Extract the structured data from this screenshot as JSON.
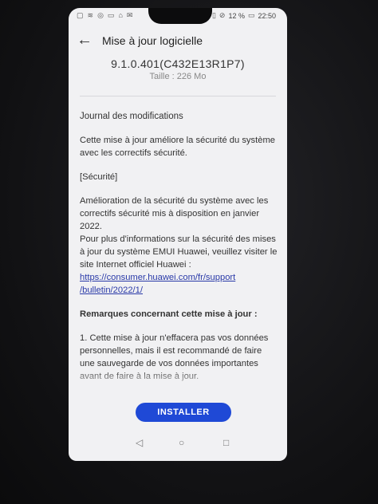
{
  "status": {
    "battery": "12 %",
    "time": "22:50"
  },
  "header": {
    "title": "Mise à jour logicielle"
  },
  "update": {
    "version": "9.1.0.401(C432E13R1P7)",
    "size": "Taille : 226 Mo"
  },
  "changelog": {
    "heading": "Journal des modifications",
    "intro": "Cette mise à jour améliore la sécurité du système avec les correctifs sécurité.",
    "section": "[Sécurité]",
    "body_lines": [
      "Amélioration de la sécurité du système avec les correctifs sécurité mis à disposition en janvier 2022.",
      "Pour plus d'informations sur la sécurité des mises à jour du système EMUI Huawei, veuillez visiter le site Internet officiel Huawei :"
    ],
    "link_line1": "https://consumer.huawei.com/fr/support",
    "link_line2": "/bulletin/2022/1/",
    "remarks_heading": "Remarques concernant cette mise à jour :",
    "remark_1": "1. Cette mise à jour n'effacera pas vos données personnelles, mais il est recommandé de faire une sauvegarde de vos données importantes avant de faire à la mise à jour."
  },
  "actions": {
    "install_label": "INSTALLER"
  },
  "icons": {
    "back": "arrow-left",
    "nav_back": "triangle-left",
    "nav_home": "circle",
    "nav_recent": "square"
  },
  "colors": {
    "accent": "#1f49d6",
    "link": "#2a3aa8",
    "screen_bg": "#f1f1f3"
  }
}
